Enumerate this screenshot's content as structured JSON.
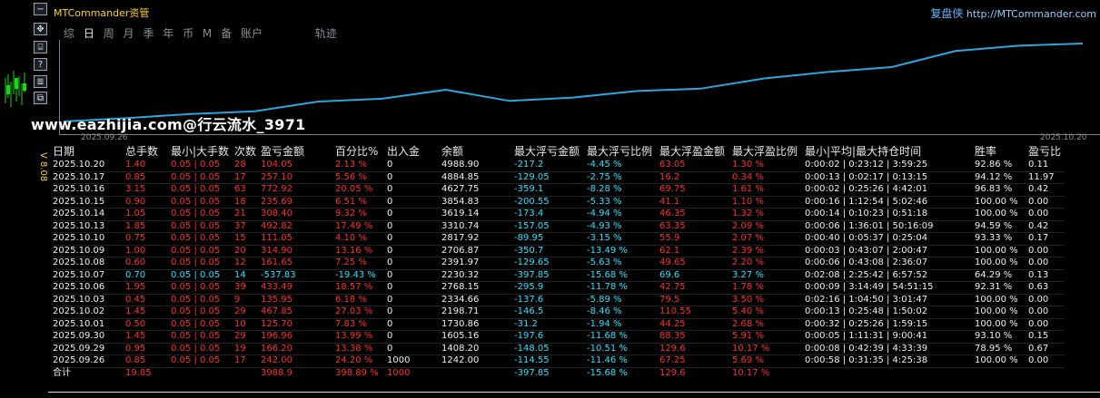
{
  "window": {
    "title": "MTCommander资管",
    "brand_name": "复盘侠",
    "brand_url": "http://MTCommander.com"
  },
  "toolbar": {
    "buttons": [
      "−",
      "✥",
      "⌸",
      "?",
      "≣",
      "⧉"
    ]
  },
  "tabs": [
    "综",
    "日",
    "周",
    "月",
    "季",
    "年",
    "币",
    "M",
    "备",
    "账户",
    "轨迹"
  ],
  "active_tab": "日",
  "chart": {
    "start_date": "2025.09.26",
    "end_date": "2025.10.20"
  },
  "chart_data": {
    "type": "line",
    "x": [
      "2025.09.26",
      "2025.09.29",
      "2025.09.30",
      "2025.10.01",
      "2025.10.02",
      "2025.10.03",
      "2025.10.06",
      "2025.10.07",
      "2025.10.08",
      "2025.10.09",
      "2025.10.10",
      "2025.10.13",
      "2025.10.14",
      "2025.10.15",
      "2025.10.16",
      "2025.10.17",
      "2025.10.20"
    ],
    "values": [
      1242.0,
      1408.2,
      1605.16,
      1730.86,
      2198.71,
      2334.66,
      2768.15,
      2230.32,
      2391.97,
      2706.87,
      2817.92,
      3310.74,
      3619.14,
      3854.83,
      4627.75,
      4884.85,
      4988.9
    ],
    "color": "#2aa6e0"
  },
  "watermark": "www.eazhijia.com@行云流水_3971",
  "side_label": "V 8.08",
  "table": {
    "headers": [
      "日期",
      "总手数",
      "最小|大手数",
      "次数",
      "盈亏金额",
      "百分比%",
      "出入金",
      "余额",
      "最大浮亏金额",
      "最大浮亏比例",
      "最大浮盈金额",
      "最大浮盈比例",
      "最小|平均|最大持仓时间",
      "胜率",
      "盈亏比"
    ],
    "rows": [
      {
        "cells": [
          "2025.10.20",
          "1.40",
          "0.05 | 0.05",
          "28",
          "104.05",
          "2.13 %",
          "0",
          "4988.90",
          "-217.2",
          "-4.45 %",
          "63.05",
          "1.30 %",
          "0:00:02 | 0:23:12 | 3:59:25",
          "92.86 %",
          "0.11"
        ],
        "loss": false
      },
      {
        "cells": [
          "2025.10.17",
          "0.85",
          "0.05 | 0.05",
          "17",
          "257.10",
          "5.56 %",
          "0",
          "4884.85",
          "-129.05",
          "-2.75 %",
          "16.2",
          "0.34 %",
          "0:00:13 | 0:02:17 | 0:13:15",
          "94.12 %",
          "11.97"
        ],
        "loss": false
      },
      {
        "cells": [
          "2025.10.16",
          "3.15",
          "0.05 | 0.05",
          "63",
          "772.92",
          "20.05 %",
          "0",
          "4627.75",
          "-359.1",
          "-8.28 %",
          "69.75",
          "1.61 %",
          "0:00:02 | 0:25:26 | 4:42:01",
          "96.83 %",
          "0.42"
        ],
        "loss": false
      },
      {
        "cells": [
          "2025.10.15",
          "0.90",
          "0.05 | 0.05",
          "18",
          "235.69",
          "6.51 %",
          "0",
          "3854.83",
          "-200.55",
          "-5.33 %",
          "41.1",
          "1.10 %",
          "0:00:16 | 1:12:54 | 5:02:46",
          "100.00 %",
          "0.00"
        ],
        "loss": false
      },
      {
        "cells": [
          "2025.10.14",
          "1.05",
          "0.05 | 0.05",
          "21",
          "308.40",
          "9.32 %",
          "0",
          "3619.14",
          "-173.4",
          "-4.94 %",
          "46.35",
          "1.32 %",
          "0:00:14 | 0:10:23 | 0:51:18",
          "100.00 %",
          "0.00"
        ],
        "loss": false
      },
      {
        "cells": [
          "2025.10.13",
          "1.85",
          "0.05 | 0.05",
          "37",
          "492.82",
          "17.49 %",
          "0",
          "3310.74",
          "-157.05",
          "-4.93 %",
          "63.35",
          "2.09 %",
          "0:00:06 | 1:36:01 | 50:16:09",
          "94.59 %",
          "0.42"
        ],
        "loss": false
      },
      {
        "cells": [
          "2025.10.10",
          "0.75",
          "0.05 | 0.05",
          "15",
          "111.05",
          "4.10 %",
          "0",
          "2817.92",
          "-89.95",
          "-3.15 %",
          "55.9",
          "2.07 %",
          "0:00:40 | 0:05:37 | 0:25:04",
          "93.33 %",
          "0.17"
        ],
        "loss": false
      },
      {
        "cells": [
          "2025.10.09",
          "1.00",
          "0.05 | 0.05",
          "20",
          "314.90",
          "13.16 %",
          "0",
          "2706.87",
          "-350.7",
          "-13.49 %",
          "62.1",
          "2.39 %",
          "0:00:03 | 0:43:07 | 2:00:47",
          "100.00 %",
          "0.00"
        ],
        "loss": false
      },
      {
        "cells": [
          "2025.10.08",
          "0.60",
          "0.05 | 0.05",
          "12",
          "161.65",
          "7.25 %",
          "0",
          "2391.97",
          "-129.65",
          "-5.63 %",
          "49.65",
          "2.20 %",
          "0:00:06 | 0:43:08 | 2:36:07",
          "100.00 %",
          "0.00"
        ],
        "loss": false
      },
      {
        "cells": [
          "2025.10.07",
          "0.70",
          "0.05 | 0.05",
          "14",
          "-537.83",
          "-19.43 %",
          "0",
          "2230.32",
          "-397.85",
          "-15.68 %",
          "69.6",
          "3.27 %",
          "0:02:08 | 2:25:42 | 6:57:52",
          "64.29 %",
          "0.13"
        ],
        "loss": true
      },
      {
        "cells": [
          "2025.10.06",
          "1.95",
          "0.05 | 0.05",
          "39",
          "433.49",
          "18.57 %",
          "0",
          "2768.15",
          "-295.9",
          "-11.78 %",
          "42.75",
          "1.78 %",
          "0:00:09 | 3:14:49 | 54:51:15",
          "92.31 %",
          "0.63"
        ],
        "loss": false
      },
      {
        "cells": [
          "2025.10.03",
          "0.45",
          "0.05 | 0.05",
          "9",
          "135.95",
          "6.18 %",
          "0",
          "2334.66",
          "-137.6",
          "-5.89 %",
          "79.5",
          "3.50 %",
          "0:02:16 | 1:04:50 | 3:01:47",
          "100.00 %",
          "0.00"
        ],
        "loss": false
      },
      {
        "cells": [
          "2025.10.02",
          "1.45",
          "0.05 | 0.05",
          "29",
          "467.85",
          "27.03 %",
          "0",
          "2198.71",
          "-146.5",
          "-8.46 %",
          "110.55",
          "5.40 %",
          "0:00:13 | 0:25:48 | 1:50:02",
          "100.00 %",
          "0.00"
        ],
        "loss": false
      },
      {
        "cells": [
          "2025.10.01",
          "0.50",
          "0.05 | 0.05",
          "10",
          "125.70",
          "7.83 %",
          "0",
          "1730.86",
          "-31.2",
          "-1.94 %",
          "44.25",
          "2.68 %",
          "0:00:32 | 0:25:26 | 1:59:15",
          "100.00 %",
          "0.00"
        ],
        "loss": false
      },
      {
        "cells": [
          "2025.09.30",
          "1.45",
          "0.05 | 0.05",
          "29",
          "196.96",
          "13.99 %",
          "0",
          "1605.16",
          "-197.6",
          "-11.68 %",
          "88.35",
          "5.91 %",
          "0:00:05 | 1:11:31 | 9:00:41",
          "93.10 %",
          "0.15"
        ],
        "loss": false
      },
      {
        "cells": [
          "2025.09.29",
          "0.95",
          "0.05 | 0.05",
          "19",
          "166.20",
          "13.38 %",
          "0",
          "1408.20",
          "-148.05",
          "-10.51 %",
          "129.6",
          "10.17 %",
          "0:00:08 | 0:42:39 | 4:33:39",
          "78.95 %",
          "0.67"
        ],
        "loss": false
      },
      {
        "cells": [
          "2025.09.26",
          "0.85",
          "0.05 | 0.05",
          "17",
          "242.00",
          "24.20 %",
          "1000",
          "1242.00",
          "-114.55",
          "-11.46 %",
          "67.25",
          "5.69 %",
          "0:00:58 | 0:31:35 | 4:25:38",
          "100.00 %",
          "0.00"
        ],
        "loss": false
      }
    ],
    "total": {
      "label": "合计",
      "lots": "19.85",
      "profit": "3988.9",
      "percent": "398.89 %",
      "deposit": "1000",
      "max_float_loss": "-397.85",
      "max_float_loss_pct": "-15.68 %",
      "max_float_profit": "129.6",
      "max_float_profit_pct": "10.17 %"
    }
  }
}
